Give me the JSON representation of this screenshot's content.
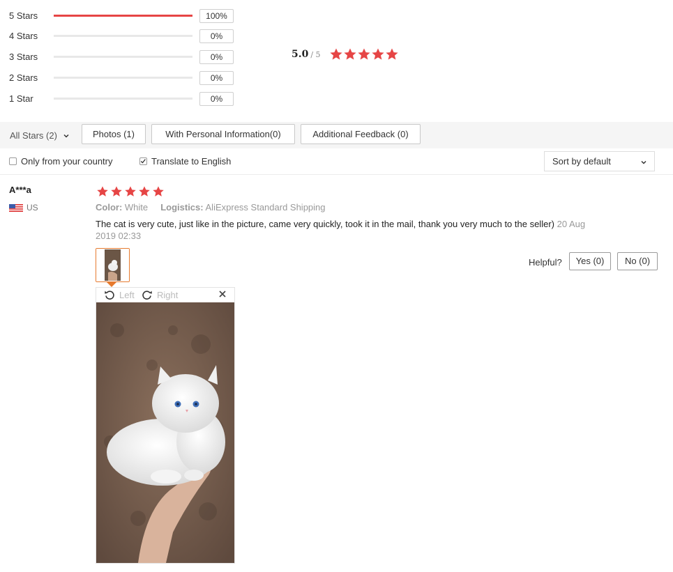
{
  "colors": {
    "accent_red": "#e64545",
    "thumb_border": "#e67a2e",
    "bar_track": "#e8e8e8"
  },
  "histogram": [
    {
      "label": "5 Stars",
      "percent": "100%",
      "fill": 1.0
    },
    {
      "label": "4 Stars",
      "percent": "0%",
      "fill": 0
    },
    {
      "label": "3 Stars",
      "percent": "0%",
      "fill": 0
    },
    {
      "label": "2 Stars",
      "percent": "0%",
      "fill": 0
    },
    {
      "label": "1 Star",
      "percent": "0%",
      "fill": 0
    }
  ],
  "average": {
    "score": "5.0",
    "out_of": "/ 5",
    "stars": 5
  },
  "filters": {
    "all_stars": "All Stars (2)",
    "photos": "Photos (1)",
    "personal": "With Personal Information(0)",
    "additional": "Additional Feedback (0)"
  },
  "options": {
    "only_country": "Only from your country",
    "only_country_checked": false,
    "translate": "Translate to English",
    "translate_checked": true,
    "sort": "Sort by default"
  },
  "review": {
    "user": "A***a",
    "country": "US",
    "stars": 5,
    "color_label": "Color:",
    "color_value": "White",
    "logistics_label": "Logistics:",
    "logistics_value": "AliExpress Standard Shipping",
    "text": "The cat is very cute, just like in the picture, came very quickly, took it in the mail, thank you very much to the seller)",
    "date": "20 Aug 2019 02:33",
    "helpful_label": "Helpful?",
    "yes": "Yes (0)",
    "no": "No (0)"
  },
  "viewer": {
    "left": "Left",
    "right": "Right"
  },
  "icons": {
    "star": "star-icon",
    "chevron": "chevron-down-icon",
    "rotate_left": "rotate-left-icon",
    "rotate_right": "rotate-right-icon",
    "close": "close-icon",
    "flag": "us-flag-icon"
  }
}
